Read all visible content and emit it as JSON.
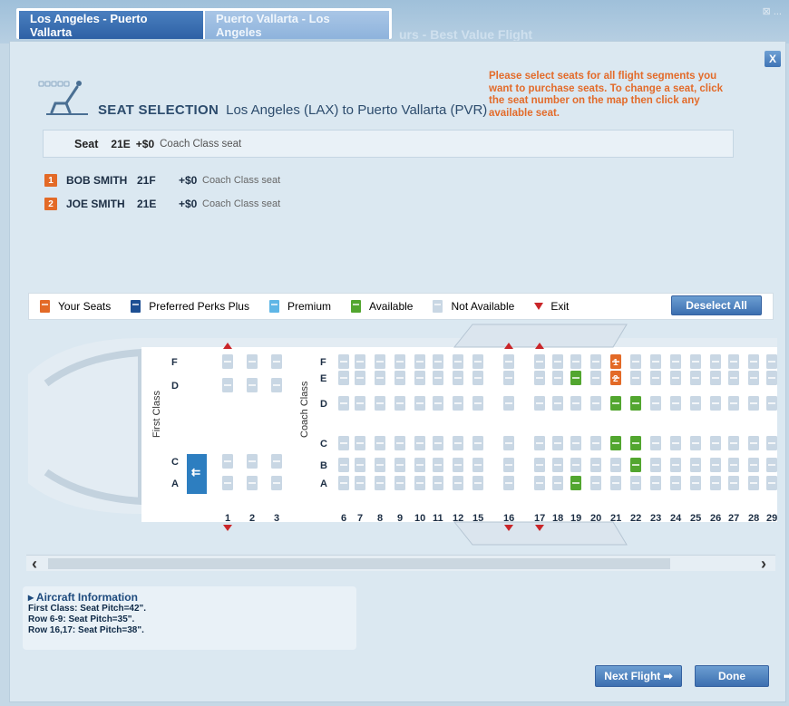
{
  "tabs": [
    {
      "label": "Los Angeles - Puerto Vallarta"
    },
    {
      "label": "Puerto Vallarta - Los Angeles"
    }
  ],
  "background_heading": "urs - Best Value Flight",
  "header": {
    "close_label": "X",
    "title": "SEAT SELECTION",
    "route": "Los Angeles (LAX) to Puerto Vallarta (PVR)",
    "instructions": "Please select seats for all flight segments you want to purchase seats. To change a seat, click the seat number on the map then click any available seat."
  },
  "current_seat": {
    "label": "Seat",
    "number": "21E",
    "price": "+$0",
    "class": "Coach Class seat"
  },
  "passengers": [
    {
      "badge": "1",
      "name": "BOB SMITH",
      "seat": "21F",
      "price": "+$0",
      "class": "Coach Class seat"
    },
    {
      "badge": "2",
      "name": "JOE SMITH",
      "seat": "21E",
      "price": "+$0",
      "class": "Coach Class seat"
    }
  ],
  "legend": [
    {
      "label": "Your Seats",
      "color": "#e36a27"
    },
    {
      "label": "Preferred Perks Plus",
      "color": "#1d4f93"
    },
    {
      "label": "Premium",
      "color": "#5fb6e6"
    },
    {
      "label": "Available",
      "color": "#52a62f"
    },
    {
      "label": "Not Available",
      "color": "#c9d7e4"
    },
    {
      "label": "Exit",
      "color": "#c9262a"
    }
  ],
  "deselect_label": "Deselect All",
  "seat_map": {
    "first_class_label": "First Class",
    "coach_class_label": "Coach Class",
    "first_letters": [
      "F",
      "D",
      "C",
      "A"
    ],
    "coach_letters": [
      "F",
      "E",
      "D",
      "C",
      "B",
      "A"
    ],
    "first_rows": [
      "1",
      "2",
      "3"
    ],
    "coach_rows": [
      "6",
      "7",
      "8",
      "9",
      "10",
      "11",
      "12",
      "15",
      "16",
      "17",
      "18",
      "19",
      "20",
      "21",
      "22",
      "23",
      "24",
      "25",
      "26",
      "27",
      "28",
      "29"
    ],
    "exit_rows": [
      "1",
      "16",
      "17"
    ],
    "available": [
      "19E",
      "21D",
      "22D",
      "21C",
      "22C",
      "22B",
      "19A"
    ],
    "your_seats": [
      {
        "seat": "21F",
        "badge": "1"
      },
      {
        "seat": "21E",
        "badge": "2"
      }
    ],
    "special_seat_icon": "lavatory-icon"
  },
  "aircraft_info": {
    "title": "Aircraft Information",
    "lines": [
      "First Class: Seat Pitch=42\".",
      "Row 6-9: Seat Pitch=35\".",
      "Row 16,17: Seat Pitch=38\"."
    ]
  },
  "buttons": {
    "next_flight": "Next Flight",
    "done": "Done"
  }
}
